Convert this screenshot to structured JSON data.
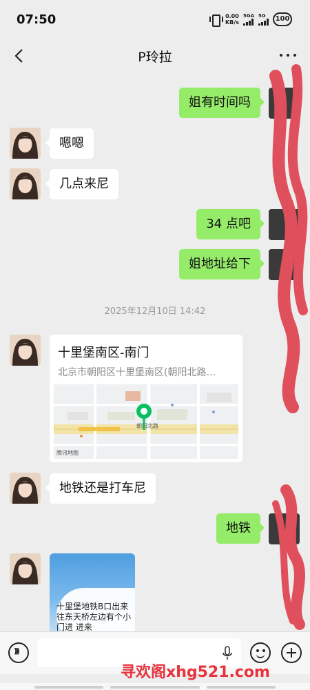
{
  "status_bar": {
    "time": "07:50",
    "net_speed_value": "0.00",
    "net_speed_unit": "KB/s",
    "sim1_label": "5GA",
    "sim2_label": "5G",
    "battery": "100"
  },
  "header": {
    "title": "P玲拉"
  },
  "messages": [
    {
      "from": "me",
      "text": "姐有时间吗"
    },
    {
      "from": "contact",
      "text": "嗯嗯"
    },
    {
      "from": "contact",
      "text": "几点来尼"
    },
    {
      "from": "me",
      "text": "34 点吧"
    },
    {
      "from": "me",
      "text": "姐地址给下"
    },
    {
      "from": "contact",
      "text": "地铁还是打车尼"
    },
    {
      "from": "me",
      "text": "地铁"
    }
  ],
  "timestamp": "2025年12月10日 14:42",
  "location_card": {
    "title": "十里堡南区-南门",
    "address": "北京市朝阳区十里堡南区(朝阳北路…",
    "map_provider": "腾讯地图",
    "map_road_label": "朝阳北路"
  },
  "photo_message": {
    "caption": "十里堡地铁B口出来 往东天桥左边有个小门进 进来"
  },
  "input_bar": {
    "placeholder": ""
  },
  "watermark": "寻欢阁xhg521.com",
  "colors": {
    "background": "#ededed",
    "outgoing_bubble": "#95ec69",
    "incoming_bubble": "#ffffff",
    "scribble": "#e0505c",
    "watermark": "#e8323c"
  },
  "icons": [
    "back-icon",
    "more-icon",
    "voice-icon",
    "mic-icon",
    "emoji-icon",
    "plus-icon",
    "location-pin-icon"
  ]
}
